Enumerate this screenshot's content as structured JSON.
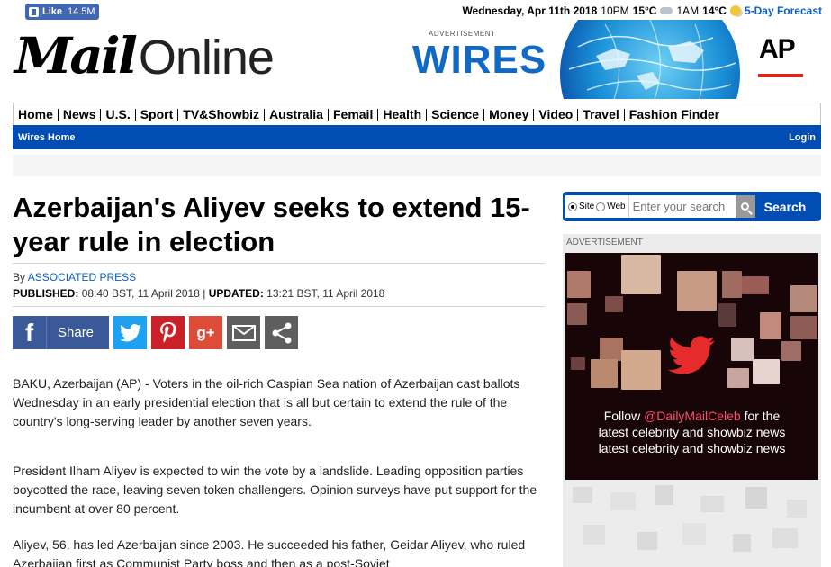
{
  "topbar": {
    "like_label": "Like",
    "like_count": "14.5M",
    "date": "Wednesday, Apr 11th 2018",
    "time1": "10PM",
    "temp1": "15°C",
    "time2": "1AM",
    "temp2": "14°C",
    "forecast_link": "5-Day Forecast"
  },
  "logo": {
    "part1": "Mail",
    "part2": "Online"
  },
  "banner": {
    "ad_label": "ADVERTISEMENT",
    "wires_text": "WIRES",
    "ap_text": "AP"
  },
  "nav": {
    "items": [
      "Home",
      "News",
      "U.S.",
      "Sport",
      "TV&Showbiz",
      "Australia",
      "Femail",
      "Health",
      "Science",
      "Money",
      "Video",
      "Travel",
      "Fashion Finder"
    ]
  },
  "subnav": {
    "left": "Wires Home",
    "right": "Login"
  },
  "article": {
    "headline": "Azerbaijan's Aliyev seeks to extend 15-year rule in election",
    "by_prefix": "By",
    "author": "ASSOCIATED PRESS",
    "published_label": "PUBLISHED:",
    "published": "08:40 BST, 11 April 2018",
    "separator": "|",
    "updated_label": "UPDATED:",
    "updated": "13:21 BST, 11 April 2018",
    "share_label": "Share",
    "paragraphs": [
      "BAKU, Azerbaijan (AP) - Voters in the oil-rich Caspian Sea nation of Azerbaijan cast ballots Wednesday in an early presidential election that is all but certain to extend the rule of the country's long-serving leader by another seven years.",
      "President Ilham Aliyev is expected to win the vote by a landslide. Leading opposition parties boycotted the race, leaving seven token challengers. Opinion surveys have put support for the incumbent at over 80 percent.",
      "Aliyev, 56, has led Azerbaijan since 2003. He succeeded his father, Geidar Aliyev, who ruled Azerbaijan first as Communist Party boss and then as a post-Soviet"
    ]
  },
  "search": {
    "site_label": "Site",
    "web_label": "Web",
    "placeholder": "Enter your search",
    "button_label": "Search"
  },
  "ad": {
    "label": "ADVERTISEMENT",
    "line1_prefix": "Follow",
    "handle": "@DailyMailCeleb",
    "line1_suffix": "for the",
    "line2": "latest celebrity and showbiz news",
    "line3": "latest celebrity and showbiz news"
  },
  "colors": {
    "brand_blue": "#004db3",
    "link_blue": "#0b61c6",
    "facebook": "#3b5998",
    "twitter": "#1da1f2",
    "pinterest": "#cb2027",
    "googleplus": "#dd4b39"
  }
}
